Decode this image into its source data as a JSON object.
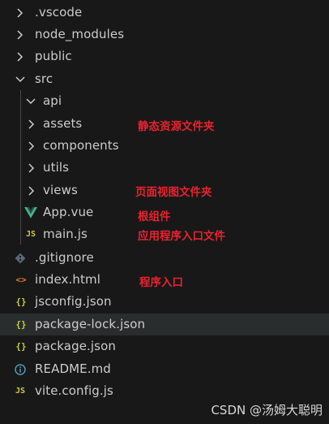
{
  "explorer": {
    "items": [
      {
        "label": ".vscode",
        "kind": "folder",
        "state": "collapsed",
        "icon": "chevron-right-icon"
      },
      {
        "label": "node_modules",
        "kind": "folder",
        "state": "collapsed",
        "icon": "chevron-right-icon"
      },
      {
        "label": "public",
        "kind": "folder",
        "state": "collapsed",
        "icon": "chevron-right-icon"
      },
      {
        "label": "src",
        "kind": "folder",
        "state": "expanded",
        "icon": "chevron-down-icon"
      },
      {
        "label": "api",
        "kind": "folder",
        "state": "expanded",
        "icon": "chevron-down-icon"
      },
      {
        "label": "assets",
        "kind": "folder",
        "state": "collapsed",
        "icon": "chevron-right-icon"
      },
      {
        "label": "components",
        "kind": "folder",
        "state": "collapsed",
        "icon": "chevron-right-icon"
      },
      {
        "label": "utils",
        "kind": "folder",
        "state": "collapsed",
        "icon": "chevron-right-icon"
      },
      {
        "label": "views",
        "kind": "folder",
        "state": "collapsed",
        "icon": "chevron-right-icon"
      },
      {
        "label": "App.vue",
        "kind": "file",
        "icon": "vue-icon",
        "icon_text": "V",
        "icon_color": "#41b883"
      },
      {
        "label": "main.js",
        "kind": "file",
        "icon": "javascript-icon",
        "icon_text": "JS",
        "icon_color": "#cbcb41"
      },
      {
        "label": ".gitignore",
        "kind": "file",
        "icon": "git-icon",
        "icon_text": "◆",
        "icon_color": "#5a6a7e"
      },
      {
        "label": "index.html",
        "kind": "file",
        "icon": "html-icon",
        "icon_text": "<>",
        "icon_color": "#e37933"
      },
      {
        "label": "jsconfig.json",
        "kind": "file",
        "icon": "json-icon",
        "icon_text": "{}",
        "icon_color": "#cbcb41"
      },
      {
        "label": "package-lock.json",
        "kind": "file",
        "icon": "json-icon",
        "icon_text": "{}",
        "icon_color": "#cbcb41"
      },
      {
        "label": "package.json",
        "kind": "file",
        "icon": "json-icon",
        "icon_text": "{}",
        "icon_color": "#cbcb41"
      },
      {
        "label": "README.md",
        "kind": "file",
        "icon": "info-icon",
        "icon_text": "i",
        "icon_color": "#519aba"
      },
      {
        "label": "vite.config.js",
        "kind": "file",
        "icon": "javascript-icon",
        "icon_text": "JS",
        "icon_color": "#cbcb41"
      }
    ]
  },
  "annotations": {
    "assets": "静态资源文件夹",
    "views": "页面视图文件夹",
    "app_vue": "根组件",
    "main_js": "应用程序入口文件",
    "index_html": "程序入口"
  },
  "colors": {
    "background": "#181818",
    "text": "#cccccc",
    "annotation": "#e8232f",
    "guide": "#4a4a4a"
  },
  "watermark": "CSDN @汤姆大聪明"
}
